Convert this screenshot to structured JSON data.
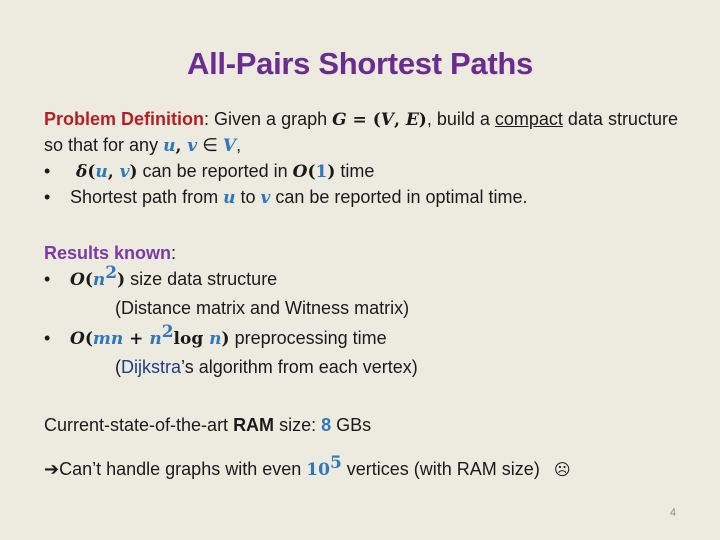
{
  "slide": {
    "title": "All-Pairs Shortest Paths",
    "page_number": "4"
  },
  "problem": {
    "label": "Problem Definition",
    "colon": ":",
    "text1": " Given a graph ",
    "G": "G",
    "eq": " = (",
    "V": "V",
    "comma": ", ",
    "E": "E",
    "close": ")",
    "text2": ", build a ",
    "compact": "compact",
    "text3": " data structure",
    "line2_text": "so that for any ",
    "u": "u",
    "uv_comma": ", ",
    "v": "v",
    "in": " ∈ ",
    "V2": "V",
    "line2_end": ",",
    "bullets": [
      {
        "delta": "δ",
        "open": "(",
        "u": "u",
        "comma": ", ",
        "v": "v",
        "close": ")",
        "text": " can be reported in ",
        "O": "O",
        "o_open": "(",
        "one": "1",
        "o_close": ")",
        "end": " time"
      },
      {
        "text1": "Shortest path from ",
        "u": "u",
        "text2": " to ",
        "v": "v",
        "text3": " can be reported in optimal time."
      }
    ]
  },
  "results": {
    "label": "Results known",
    "colon": ":",
    "items": [
      {
        "O": "O",
        "open": "(",
        "n": "n",
        "sup": "2",
        "close": ")",
        "text": " size data structure",
        "note": "(Distance matrix and Witness matrix)"
      },
      {
        "O": "O",
        "open": "(",
        "mn": "mn",
        "plus": " + ",
        "n": "n",
        "sup": "2",
        "log": "log ",
        "n2": "n",
        "close": ")",
        "text": " preprocessing time",
        "note_open": "(",
        "note_link": "Dijkstra",
        "note_rest": "’s algorithm from each vertex)"
      }
    ]
  },
  "ram": {
    "text1": "Current-state-of-the-art ",
    "bold": "RAM",
    "text2": " size: ",
    "value": "8",
    "unit": " GBs"
  },
  "conclusion": {
    "arrow": "➔",
    "text1": "Can’t handle graphs with even ",
    "base": "10",
    "exp": "5",
    "text2": " vertices (with RAM size)",
    "face": "☹"
  },
  "colors": {
    "title": "#6b2c91",
    "problem_label": "#b81d24",
    "results_label": "#7c3aa8",
    "math_accent": "#2e78bf",
    "background": "#edeae0"
  }
}
